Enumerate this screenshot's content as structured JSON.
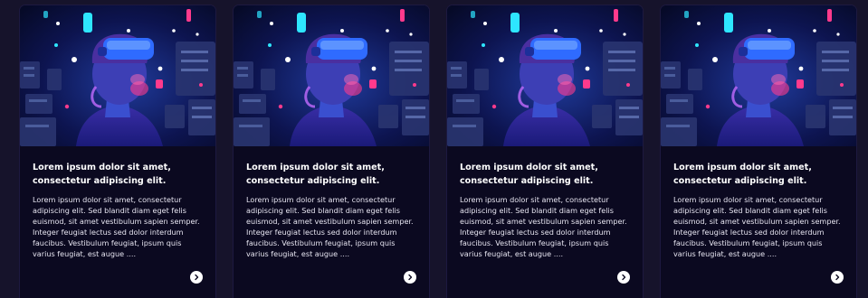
{
  "cards": [
    {
      "title": "Lorem ipsum dolor sit amet, consectetur adipiscing elit.",
      "text": "Lorem ipsum dolor sit amet, consectetur adipiscing elit. Sed blandit diam eget felis euismod, sit amet vestibulum sapien semper. Integer feugiat lectus sed dolor interdum faucibus. Vestibulum feugiat, ipsum quis varius feugiat, est augue ....",
      "image_icon": "vr-headset-illustration",
      "action_icon": "chevron-right-icon"
    },
    {
      "title": "Lorem ipsum dolor sit amet, consectetur adipiscing elit.",
      "text": "Lorem ipsum dolor sit amet, consectetur adipiscing elit. Sed blandit diam eget felis euismod, sit amet vestibulum sapien semper. Integer feugiat lectus sed dolor interdum faucibus. Vestibulum feugiat, ipsum quis varius feugiat, est augue ....",
      "image_icon": "vr-headset-illustration",
      "action_icon": "chevron-right-icon"
    },
    {
      "title": "Lorem ipsum dolor sit amet, consectetur adipiscing elit.",
      "text": "Lorem ipsum dolor sit amet, consectetur adipiscing elit. Sed blandit diam eget felis euismod, sit amet vestibulum sapien semper. Integer feugiat lectus sed dolor interdum faucibus. Vestibulum feugiat, ipsum quis varius feugiat, est augue ....",
      "image_icon": "vr-headset-illustration",
      "action_icon": "chevron-right-icon"
    },
    {
      "title": "Lorem ipsum dolor sit amet, consectetur adipiscing elit.",
      "text": "Lorem ipsum dolor sit amet, consectetur adipiscing elit. Sed blandit diam eget felis euismod, sit amet vestibulum sapien semper. Integer feugiat lectus sed dolor interdum faucibus. Vestibulum feugiat, ipsum quis varius feugiat, est augue ....",
      "image_icon": "vr-headset-illustration",
      "action_icon": "chevron-right-icon"
    }
  ],
  "colors": {
    "page_background": "#16132b",
    "card_background": "#0b0920",
    "neon_pink": "#ff3a8c",
    "neon_cyan": "#2ee6ff",
    "headset_blue": "#2f6bff"
  }
}
